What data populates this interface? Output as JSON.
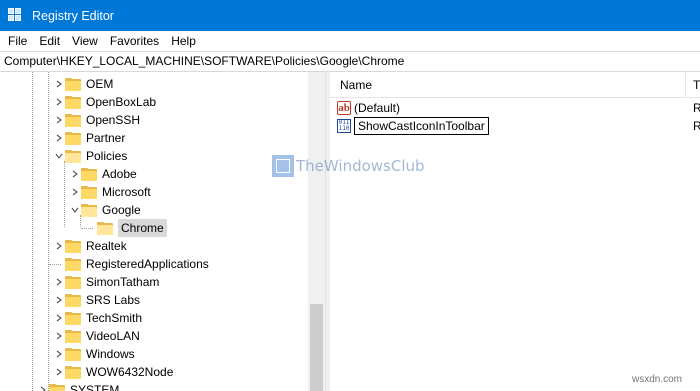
{
  "window": {
    "title": "Registry Editor"
  },
  "menu": [
    "File",
    "Edit",
    "View",
    "Favorites",
    "Help"
  ],
  "address": "Computer\\HKEY_LOCAL_MACHINE\\SOFTWARE\\Policies\\Google\\Chrome",
  "tree": {
    "items": [
      {
        "label": "OEM",
        "expander": "collapsed",
        "level": 0
      },
      {
        "label": "OpenBoxLab",
        "expander": "collapsed",
        "level": 0
      },
      {
        "label": "OpenSSH",
        "expander": "collapsed",
        "level": 0
      },
      {
        "label": "Partner",
        "expander": "collapsed",
        "level": 0
      },
      {
        "label": "Policies",
        "expander": "expanded",
        "level": 0
      },
      {
        "label": "Adobe",
        "expander": "collapsed",
        "level": 1
      },
      {
        "label": "Microsoft",
        "expander": "collapsed",
        "level": 1
      },
      {
        "label": "Google",
        "expander": "expanded",
        "level": 1
      },
      {
        "label": "Chrome",
        "expander": "none",
        "level": 2,
        "selected": true
      },
      {
        "label": "Realtek",
        "expander": "collapsed",
        "level": 0
      },
      {
        "label": "RegisteredApplications",
        "expander": "none",
        "level": 0
      },
      {
        "label": "SimonTatham",
        "expander": "collapsed",
        "level": 0
      },
      {
        "label": "SRS Labs",
        "expander": "collapsed",
        "level": 0
      },
      {
        "label": "TechSmith",
        "expander": "collapsed",
        "level": 0
      },
      {
        "label": "VideoLAN",
        "expander": "collapsed",
        "level": 0
      },
      {
        "label": "Windows",
        "expander": "collapsed",
        "level": 0
      },
      {
        "label": "WOW6432Node",
        "expander": "collapsed",
        "level": 0
      },
      {
        "label": "SYSTEM",
        "expander": "collapsed",
        "level": -1
      }
    ]
  },
  "list": {
    "columns": {
      "name": "Name",
      "type": "T"
    },
    "values": [
      {
        "icon": "string-value-icon",
        "name": "(Default)",
        "type": "R",
        "editing": false
      },
      {
        "icon": "binary-value-icon",
        "name": "ShowCastIconInToolbar",
        "type": "R",
        "editing": true
      }
    ]
  },
  "watermarks": {
    "center": "TheWindowsClub",
    "corner": "wsxdn.com"
  }
}
